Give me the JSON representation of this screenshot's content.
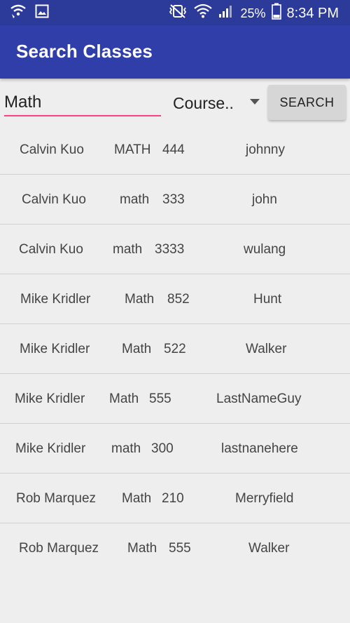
{
  "status_bar": {
    "battery": "25%",
    "time": "8:34 PM"
  },
  "app_bar": {
    "title": "Search Classes"
  },
  "search": {
    "query": "Math",
    "filter_value": "Course..",
    "button_label": "SEARCH"
  },
  "results": [
    {
      "instructor": "Calvin Kuo",
      "subject": "MATH",
      "number": "444",
      "extra": "johnny"
    },
    {
      "instructor": "Calvin Kuo",
      "subject": "math",
      "number": "333",
      "extra": "john"
    },
    {
      "instructor": "Calvin Kuo",
      "subject": "math",
      "number": "3333",
      "extra": "wulang"
    },
    {
      "instructor": "Mike Kridler",
      "subject": "Math",
      "number": "852",
      "extra": "Hunt"
    },
    {
      "instructor": "Mike Kridler",
      "subject": "Math",
      "number": "522",
      "extra": "Walker"
    },
    {
      "instructor": "Mike Kridler",
      "subject": "Math",
      "number": "555",
      "extra": "LastNameGuy"
    },
    {
      "instructor": "Mike Kridler",
      "subject": "math",
      "number": "300",
      "extra": "lastnanehere"
    },
    {
      "instructor": "Rob Marquez",
      "subject": "Math",
      "number": "210",
      "extra": "Merryfield"
    },
    {
      "instructor": "Rob Marquez",
      "subject": "Math",
      "number": "555",
      "extra": "Walker"
    }
  ]
}
